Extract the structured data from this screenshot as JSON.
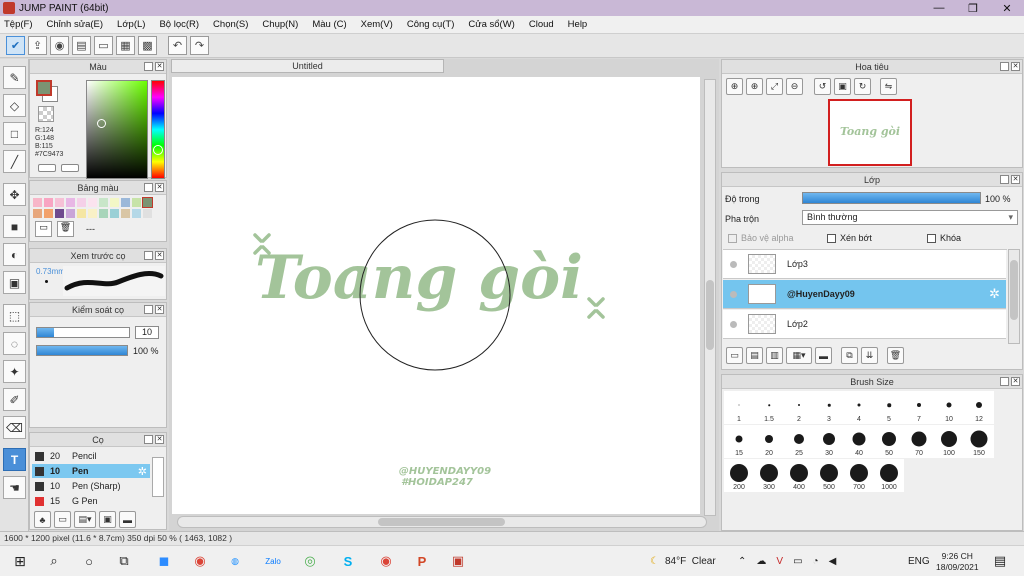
{
  "window": {
    "title": "JUMP PAINT (64bit)",
    "minimize": "—",
    "maximize": "❐",
    "close": "✕"
  },
  "menu": [
    "Tệp(F)",
    "Chỉnh sửa(E)",
    "Lớp(L)",
    "Bộ lọc(R)",
    "Chọn(S)",
    "Chụp(N)",
    "Màu (C)",
    "Xem(V)",
    "Công cụ(T)",
    "Cửa sổ(W)",
    "Cloud",
    "Help"
  ],
  "toolbar_icons": [
    "check-icon",
    "share-icon",
    "comment-icon",
    "message-icon",
    "page-icon",
    "document-icon",
    "grid-icon",
    "undo-icon",
    "redo-icon"
  ],
  "tools": [
    "brush-tool",
    "eraser-tool",
    "select-rect-tool",
    "line-tool",
    "move-tool",
    "fill-rect-tool",
    "bucket-tool",
    "gradient-tool",
    "marquee-tool",
    "lasso-tool",
    "magic-wand-tool",
    "selection-pen-tool",
    "selection-eraser-tool",
    "text-tool",
    "hand-tool"
  ],
  "color_panel": {
    "title": "Màu",
    "fg_color": "#7C9473",
    "rgb": {
      "r": "R:124",
      "g": "G:148",
      "b": "B:115",
      "hex": "#7C9473"
    }
  },
  "palette_panel": {
    "title": "Bảng màu",
    "colors": [
      "#f7b6c8",
      "#f8a5c2",
      "#f6c1d6",
      "#e8b7e5",
      "#f5d0e8",
      "#fbe3ef",
      "#c8e6c9",
      "#f3f7c6",
      "#9bb8d9",
      "#c7e3a8",
      "#7c9473",
      "#e7a77d",
      "#f2a16b",
      "#6f4a8e",
      "#c9a5d8",
      "#f5e6a3",
      "#f9f1c7",
      "#a8d5ba",
      "#9ad0d6",
      "#d9c6a5",
      "#b4d8e7",
      "#e0e0e0"
    ],
    "dash_label": "---"
  },
  "brush_preview_panel": {
    "title": "Xem trước cọ",
    "size": "0.73mm"
  },
  "brush_control_panel": {
    "title": "Kiểm soát cọ",
    "size_value": "10",
    "size_fraction": 0.18,
    "opacity_value": "100 %",
    "opacity_fraction": 1.0
  },
  "brush_panel": {
    "title": "Cọ",
    "items": [
      {
        "num": "20",
        "name": "Pencil",
        "chip": "#333333",
        "selected": false
      },
      {
        "num": "10",
        "name": "Pen",
        "chip": "#333333",
        "selected": true
      },
      {
        "num": "10",
        "name": "Pen (Sharp)",
        "chip": "#333333",
        "selected": false
      },
      {
        "num": "15",
        "name": "G Pen",
        "chip": "#e03131",
        "selected": false
      }
    ]
  },
  "canvas": {
    "tab_title": "Untitled",
    "artwork_text": "Toang gòi",
    "watermark_line1": "@HUYENDAYY09",
    "watermark_line2": "#HOIDAP247",
    "text_color": "#a3c49a"
  },
  "status": {
    "text": "1600 * 1200 pixel  (11.6 * 8.7cm)  350 dpi  50 %  ( 1463, 1082 )"
  },
  "navigator_panel": {
    "title": "Hoa tiêu",
    "thumb_text": "Toang gòi"
  },
  "layer_panel": {
    "title": "Lớp",
    "opacity_label": "Độ trong",
    "opacity_value": "100 %",
    "opacity_fraction": 1.0,
    "blend_label": "Pha trộn",
    "blend_value": "Bình thường",
    "protect_alpha": "Bảo vệ alpha",
    "clipping": "Xén bớt",
    "lock": "Khóa",
    "layers": [
      {
        "name": "Lớp3",
        "selected": false
      },
      {
        "name": "@HuyenDayy09",
        "selected": true
      },
      {
        "name": "Lớp2",
        "selected": false
      }
    ]
  },
  "brush_size_panel": {
    "title": "Brush Size",
    "sizes": [
      "1",
      "1.5",
      "2",
      "3",
      "4",
      "5",
      "7",
      "10",
      "12",
      "15",
      "20",
      "25",
      "30",
      "40",
      "50",
      "70",
      "100",
      "150",
      "200",
      "300",
      "400",
      "500",
      "700",
      "1000"
    ]
  },
  "taskbar": {
    "weather_temp": "84°F",
    "weather_text": "Clear",
    "lang": "ENG",
    "time": "9:26 CH",
    "date": "18/09/2021"
  }
}
